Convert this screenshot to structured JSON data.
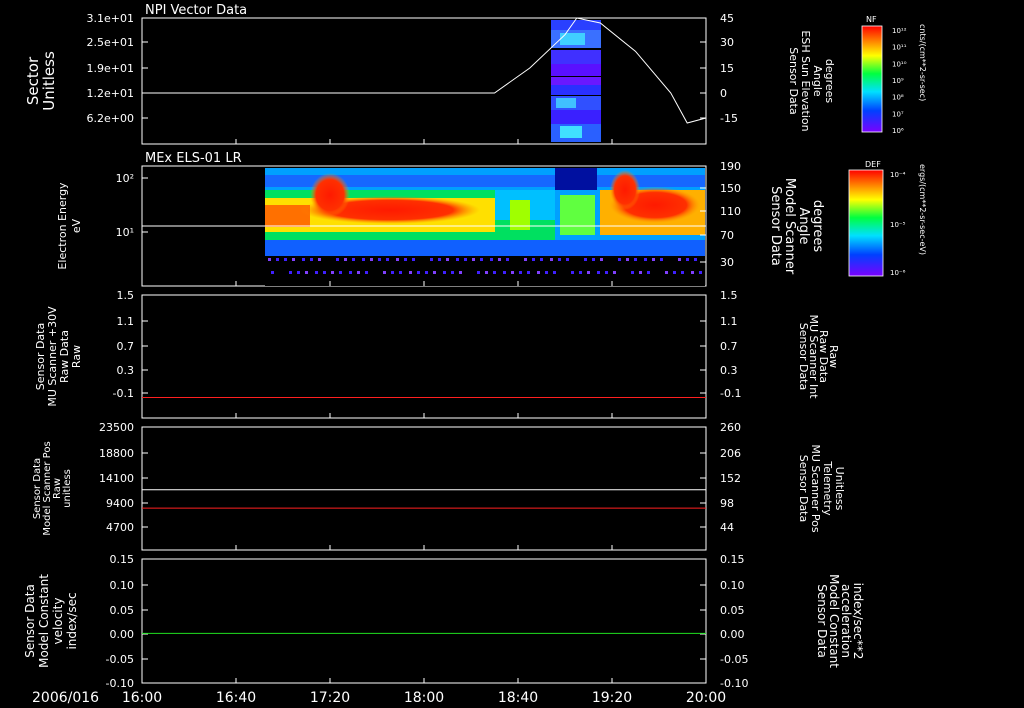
{
  "time_axis": {
    "date_label": "2006/016",
    "ticks": [
      "16:00",
      "16:40",
      "17:20",
      "18:00",
      "18:40",
      "19:20",
      "20:00"
    ]
  },
  "panels": [
    {
      "title": "NPI Vector Data",
      "left_label": [
        "Sector",
        "Unitless"
      ],
      "right_label": [
        "Sensor Data",
        "ESH Sun Elevation",
        "Angle",
        "degrees"
      ],
      "left_ticks": [
        "3.1e+01",
        "2.5e+01",
        "1.9e+01",
        "1.2e+01",
        "6.2e+00"
      ],
      "right_ticks": [
        "45",
        "30",
        "15",
        "0",
        "-15"
      ]
    },
    {
      "title": "MEx ELS-01 LR",
      "left_label": [
        "Electron Energy",
        "eV"
      ],
      "right_label": [
        "Sensor Data",
        "Model Scanner",
        "Angle",
        "degrees"
      ],
      "left_ticks": [
        "10²",
        "10¹"
      ],
      "right_ticks": [
        "190",
        "150",
        "110",
        "70",
        "30"
      ]
    },
    {
      "title": "",
      "left_label": [
        "Sensor Data",
        "MU Scanner +30V",
        "Raw Data",
        "Raw"
      ],
      "right_label": [
        "Sensor Data",
        "MU Scanner Int",
        "Raw Data",
        "Raw"
      ],
      "left_ticks": [
        "1.5",
        "1.1",
        "0.7",
        "0.3",
        "-0.1"
      ],
      "right_ticks": [
        "1.5",
        "1.1",
        "0.7",
        "0.3",
        "-0.1"
      ]
    },
    {
      "title": "",
      "left_label": [
        "Sensor Data",
        "Model Scanner Pos",
        "Raw",
        "unitless"
      ],
      "right_label": [
        "Sensor Data",
        "MU Scanner Pos",
        "Telemetry",
        "Unitless"
      ],
      "left_ticks": [
        "23500",
        "18800",
        "14100",
        "9400",
        "4700"
      ],
      "right_ticks": [
        "260",
        "206",
        "152",
        "98",
        "44"
      ]
    },
    {
      "title": "",
      "left_label": [
        "Sensor Data",
        "Model Constant",
        "velocity",
        "index/sec"
      ],
      "right_label": [
        "Sensor Data",
        "Model Constant",
        "acceleration",
        "index/sec**2"
      ],
      "left_ticks": [
        "0.15",
        "0.10",
        "0.05",
        "0.00",
        "-0.05",
        "-0.10"
      ],
      "right_ticks": [
        "0.15",
        "0.10",
        "0.05",
        "0.00",
        "-0.05",
        "-0.10"
      ]
    }
  ],
  "colorbars": [
    {
      "tag": "NF",
      "unit": "cnts/(cm**2-sr-sec)",
      "labels": [
        "10¹²",
        "10¹¹",
        "10¹⁰",
        "10⁹",
        "10⁸",
        "10⁷",
        "10⁶"
      ]
    },
    {
      "tag": "DEF",
      "unit": "ergs/(cm**2-sr-sec-eV)",
      "labels": [
        "10⁻⁴",
        "10⁻⁵",
        "10⁻⁶"
      ]
    }
  ],
  "colors": {
    "white": "#ffffff",
    "red": "#ff2020",
    "green": "#20e020",
    "frame": "#ffffff"
  },
  "chart_data": [
    {
      "type": "line",
      "title": "NPI Vector Data",
      "xrange": [
        "16:00",
        "20:00"
      ],
      "series": [
        {
          "name": "Sensor Data ESH Sun Elevation Angle",
          "color": "#ffffff",
          "x": [
            "16:00",
            "18:00",
            "18:30",
            "18:45",
            "19:00",
            "19:05",
            "19:15",
            "19:30",
            "19:45",
            "19:52",
            "20:00"
          ],
          "y": [
            0,
            0,
            0,
            15,
            35,
            45,
            42,
            25,
            0,
            -18,
            -15
          ]
        }
      ],
      "spectrogram_window": [
        "18:50",
        "19:10"
      ]
    },
    {
      "type": "heatmap",
      "title": "MEx ELS-01 LR",
      "xrange": [
        "16:00",
        "20:00"
      ],
      "data_start": "16:50",
      "ylabel": "Electron Energy eV",
      "series": [
        {
          "name": "Sensor Data Model Scanner Angle",
          "color": "#ffffff",
          "y": 90
        }
      ]
    },
    {
      "type": "line",
      "ylim": [
        -0.3,
        1.5
      ],
      "series": [
        {
          "name": "Sensor Data MU Scanner Int Raw Data Raw",
          "color": "#ff2020",
          "y": 0
        }
      ]
    },
    {
      "type": "line",
      "ylim": [
        0,
        23500
      ],
      "series": [
        {
          "name": "Sensor Data Model Scanner Pos Raw unitless",
          "color": "#ffffff",
          "y": 11500
        },
        {
          "name": "Sensor Data MU Scanner Pos Telemetry Unitless",
          "color": "#ff2020",
          "y": 8000
        }
      ]
    },
    {
      "type": "line",
      "ylim": [
        -0.1,
        0.15
      ],
      "series": [
        {
          "name": "Sensor Data Model Constant acceleration index/sec**2",
          "color": "#20e020",
          "y": 0.0
        }
      ]
    }
  ]
}
